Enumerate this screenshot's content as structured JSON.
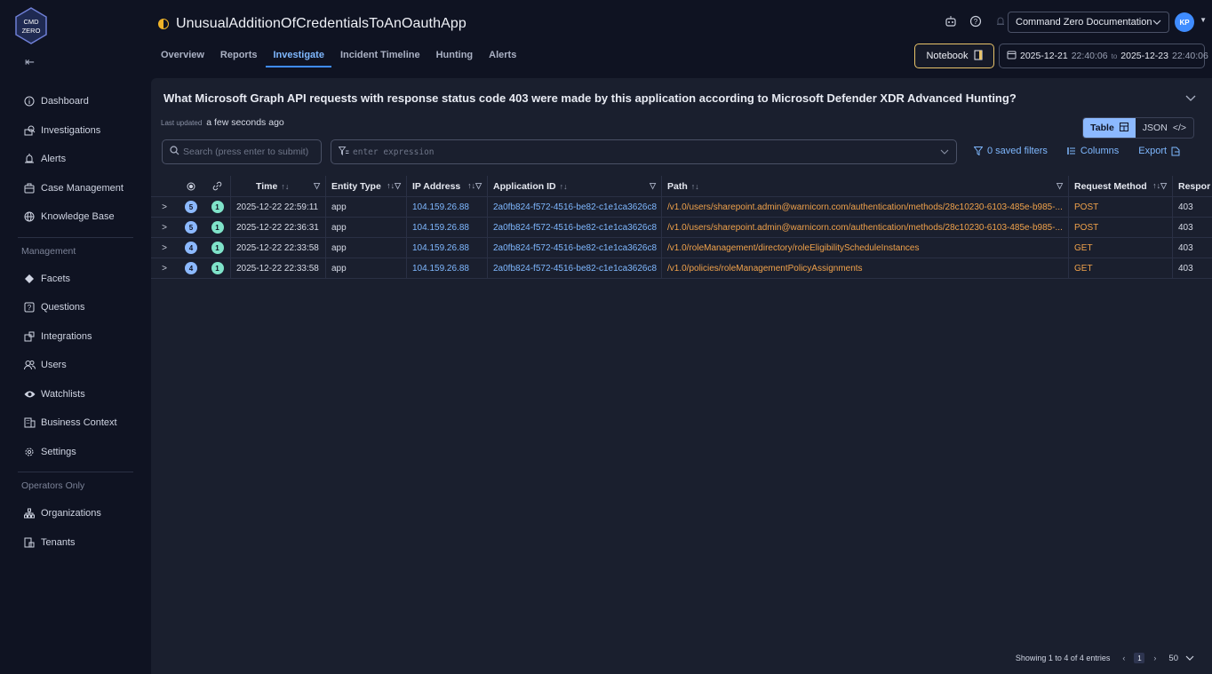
{
  "brand": {
    "logo_text": "CMD ZERO"
  },
  "sidebar": {
    "items": [
      {
        "label": "Dashboard",
        "icon": "info-circle-icon"
      },
      {
        "label": "Investigations",
        "icon": "investigations-icon"
      },
      {
        "label": "Alerts",
        "icon": "alert-icon"
      },
      {
        "label": "Case Management",
        "icon": "briefcase-icon"
      },
      {
        "label": "Knowledge Base",
        "icon": "globe-icon"
      }
    ],
    "management_label": "Management",
    "management_items": [
      {
        "label": "Facets",
        "icon": "diamond-icon"
      },
      {
        "label": "Questions",
        "icon": "question-box-icon"
      },
      {
        "label": "Integrations",
        "icon": "integrations-icon"
      },
      {
        "label": "Users",
        "icon": "users-icon"
      },
      {
        "label": "Watchlists",
        "icon": "eye-icon"
      },
      {
        "label": "Business Context",
        "icon": "building-icon"
      },
      {
        "label": "Settings",
        "icon": "gear-icon"
      }
    ],
    "operators_label": "Operators Only",
    "operators_items": [
      {
        "label": "Organizations",
        "icon": "org-chart-icon"
      },
      {
        "label": "Tenants",
        "icon": "tenants-icon"
      }
    ]
  },
  "header": {
    "title": "UnusualAdditionOfCredentialsToAnOauthApp",
    "tabs": [
      "Overview",
      "Reports",
      "Investigate",
      "Incident Timeline",
      "Hunting",
      "Alerts"
    ],
    "active_tab": "Investigate",
    "doc_select": "Command Zero Documentation",
    "avatar": "KP",
    "notebook_label": "Notebook",
    "date_from": "2025-12-21",
    "time_from": "22:40:06",
    "date_to_sep": "to",
    "date_to": "2025-12-23",
    "time_to": "22:40:06"
  },
  "panel": {
    "question": "What Microsoft Graph API requests with response status code 403 were made by this application according to Microsoft Defender XDR Advanced Hunting?",
    "last_updated_label": "Last updated",
    "last_updated_value": "a few seconds ago",
    "view_table": "Table",
    "view_json": "JSON",
    "search_placeholder": "Search (press enter to submit)",
    "expr_placeholder": "enter expression",
    "saved_filters": "0 saved filters",
    "columns": "Columns",
    "export": "Export"
  },
  "table": {
    "headers": {
      "time": "Time",
      "entity_type": "Entity Type",
      "ip": "IP Address",
      "app_id": "Application ID",
      "path": "Path",
      "method": "Request Method",
      "response": "Respor"
    },
    "rows": [
      {
        "a": "5",
        "b": "1",
        "time": "2025-12-22 22:59:11",
        "type": "app",
        "ip": "104.159.26.88",
        "app_id": "2a0fb824-f572-4516-be82-c1e1ca3626c8",
        "path": "/v1.0/users/sharepoint.admin@warnicorn.com/authentication/methods/28c10230-6103-485e-b985-...",
        "method": "POST",
        "resp": "403"
      },
      {
        "a": "5",
        "b": "1",
        "time": "2025-12-22 22:36:31",
        "type": "app",
        "ip": "104.159.26.88",
        "app_id": "2a0fb824-f572-4516-be82-c1e1ca3626c8",
        "path": "/v1.0/users/sharepoint.admin@warnicorn.com/authentication/methods/28c10230-6103-485e-b985-...",
        "method": "POST",
        "resp": "403"
      },
      {
        "a": "4",
        "b": "1",
        "time": "2025-12-22 22:33:58",
        "type": "app",
        "ip": "104.159.26.88",
        "app_id": "2a0fb824-f572-4516-be82-c1e1ca3626c8",
        "path": "/v1.0/roleManagement/directory/roleEligibilityScheduleInstances",
        "method": "GET",
        "resp": "403"
      },
      {
        "a": "4",
        "b": "1",
        "time": "2025-12-22 22:33:58",
        "type": "app",
        "ip": "104.159.26.88",
        "app_id": "2a0fb824-f572-4516-be82-c1e1ca3626c8",
        "path": "/v1.0/policies/roleManagementPolicyAssignments",
        "method": "GET",
        "resp": "403"
      }
    ]
  },
  "footer": {
    "showing": "Showing 1 to 4 of 4 entries",
    "page": "1",
    "page_size": "50"
  }
}
